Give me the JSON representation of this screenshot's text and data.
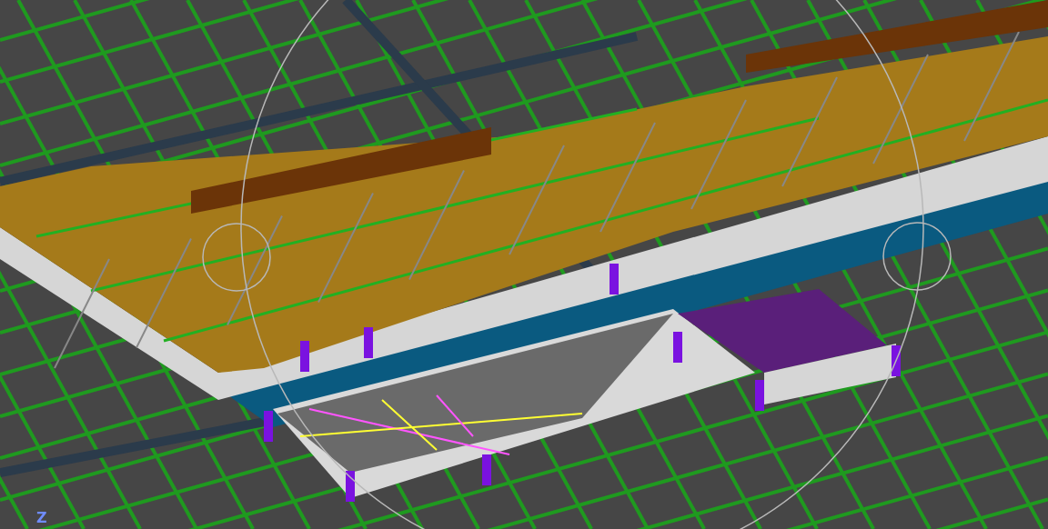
{
  "viewport": {
    "axis_label": "Z"
  }
}
